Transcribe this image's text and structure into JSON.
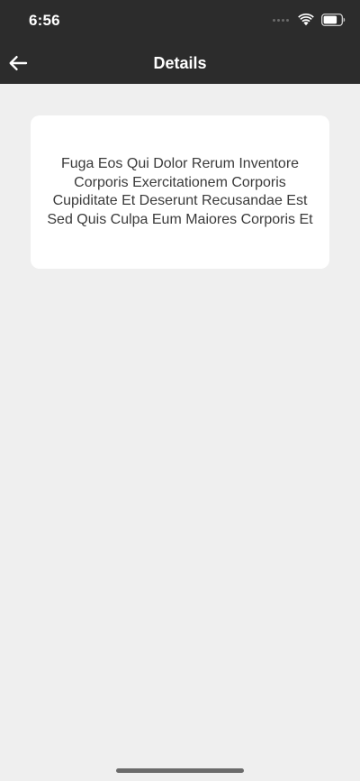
{
  "status_bar": {
    "time": "6:56",
    "icons": [
      "signal-dots",
      "wifi-icon",
      "battery-icon"
    ]
  },
  "nav": {
    "title": "Details",
    "back_icon": "arrow-left-icon"
  },
  "card": {
    "text": "Fuga Eos Qui Dolor Rerum Inventore Corporis Exercitationem Corporis Cupiditate Et Deserunt Recusandae Est Sed Quis Culpa Eum Maiores Corporis Et"
  },
  "colors": {
    "header_bg": "#2c2c2c",
    "page_bg": "#efefef",
    "card_bg": "#ffffff",
    "text": "#3a3a3a"
  }
}
